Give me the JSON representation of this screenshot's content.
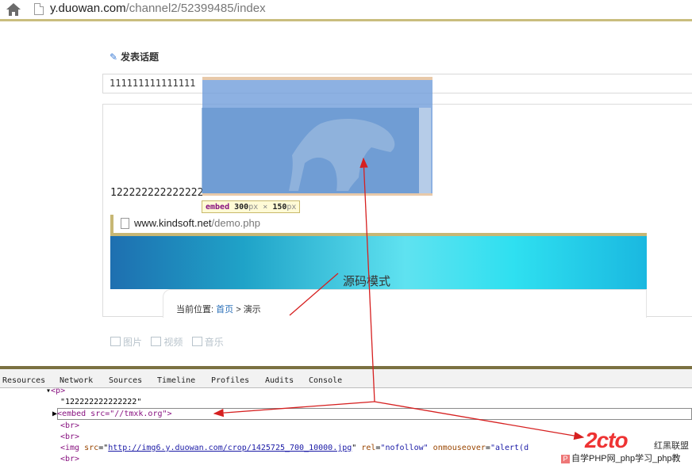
{
  "browser": {
    "url_host": "y.duowan.com",
    "url_path": "/channel2/52399485/index"
  },
  "editor": {
    "heading": "发表话题",
    "title_value": "111111111111111",
    "body_text": "122222222222222"
  },
  "embed_tooltip": {
    "tag": "embed",
    "width": "300",
    "height": "150",
    "unit": "px",
    "times": "×"
  },
  "iframe_preview": {
    "url_host": "www.kindsoft.net",
    "url_path": "/demo.php",
    "breadcrumb_label": "当前位置:",
    "breadcrumb_home": "首页",
    "breadcrumb_sep": ">",
    "breadcrumb_current": "演示"
  },
  "annotation": {
    "mode_label": "源码模式"
  },
  "media_toolbar": {
    "image": "图片",
    "video": "视频",
    "music": "音乐"
  },
  "devtools": {
    "tabs": [
      "Resources",
      "Network",
      "Sources",
      "Timeline",
      "Profiles",
      "Audits",
      "Console"
    ],
    "lines": {
      "p_open": "<p>",
      "text_node": "\"122222222222222\"",
      "embed_line": "<embed src=\"//tmxk.org\">",
      "br": "<br>",
      "img_tag": "<img",
      "img_src_attr": "src",
      "img_src_val": "http://img6.y.duowan.com/crop/1425725_700_10000.jpg",
      "img_rel_attr": "rel",
      "img_rel_val": "\"nofollow\"",
      "img_onmouse_attr": "onmouseover",
      "img_onmouse_val": "\"alert(d"
    }
  },
  "watermarks": {
    "logo_text": "2cto",
    "logo_caption": "红黑联盟",
    "footer_badge": "P",
    "footer_text": "自学PHP网_php学习_php教"
  }
}
